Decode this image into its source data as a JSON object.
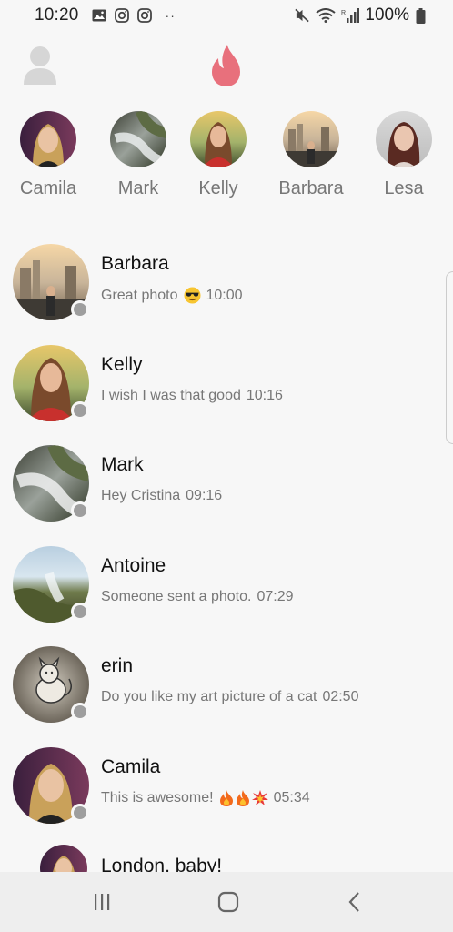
{
  "status_bar": {
    "time": "10:20",
    "battery": "100%",
    "icons_left": [
      "gallery-icon",
      "instagram-icon",
      "instagram-icon",
      "more-dots"
    ],
    "dots": "··",
    "icons_right": [
      "mute-icon",
      "wifi-icon",
      "signal-icon",
      "battery-icon"
    ]
  },
  "header": {
    "profile_icon": "profile-icon",
    "logo_icon": "flame-icon",
    "accent_color": "#e8707c"
  },
  "stories": [
    {
      "name": "Camila"
    },
    {
      "name": "Mark"
    },
    {
      "name": "Kelly"
    },
    {
      "name": "Barbara"
    },
    {
      "name": "Lesa"
    }
  ],
  "messages": [
    {
      "name": "Barbara",
      "preview": "Great photo",
      "emoji": "sunglasses",
      "time": "10:00"
    },
    {
      "name": "Kelly",
      "preview": "I wish I was that good",
      "time": "10:16"
    },
    {
      "name": "Mark",
      "preview": "Hey Cristina ",
      "time": "09:16"
    },
    {
      "name": "Antoine",
      "preview": "Someone sent a photo.",
      "time": "07:29"
    },
    {
      "name": "erin",
      "preview": "Do you like my art picture of a cat ",
      "time": "02:50"
    },
    {
      "name": "Camila",
      "preview": "This is awesome!",
      "emoji": "fire fire boom",
      "time": "05:34"
    },
    {
      "name": "London, baby!",
      "preview": "",
      "time": ""
    }
  ],
  "nav_bar": {
    "buttons": [
      "recents-button",
      "home-button",
      "back-button"
    ]
  }
}
